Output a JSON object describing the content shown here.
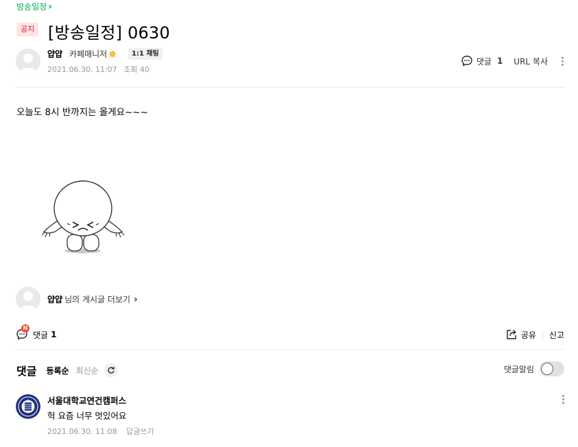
{
  "board": {
    "name": "방송일정",
    "chevron": "›"
  },
  "post": {
    "badge": "공지",
    "title": "[방송일정] 0630",
    "author": "얍얍",
    "role": "카페매니저",
    "chat_button": "1:1 채팅",
    "date": "2021.06.30. 11:07",
    "views": "조회 40",
    "body": "오늘도 8시 반까지는 올게요~~~",
    "image_icon": "crying-character-sticker"
  },
  "top_actions": {
    "comment_label": "댓글",
    "comment_count": "1",
    "url_copy": "URL 복사"
  },
  "author_more": {
    "name": "얍얍",
    "suffix": "님의 게시글 더보기",
    "chevron": "›"
  },
  "bottom_bar": {
    "comment_label": "댓글",
    "comment_count": "1",
    "new_badge": "N",
    "share": "공유",
    "report": "신고"
  },
  "comments": {
    "title": "댓글",
    "sort_registered": "등록순",
    "sort_latest": "최신순",
    "notify_label": "댓글알림",
    "items": [
      {
        "author": "서울대학교연건캠퍼스",
        "text": "헉 요즘 너무 멋있어요",
        "date": "2021.06.30. 11:08",
        "reply": "답글쓰기"
      }
    ]
  },
  "colors": {
    "accent_green": "#03a94d",
    "notice_red": "#e4172b",
    "muted": "#979797",
    "divider": "#ebecef"
  }
}
